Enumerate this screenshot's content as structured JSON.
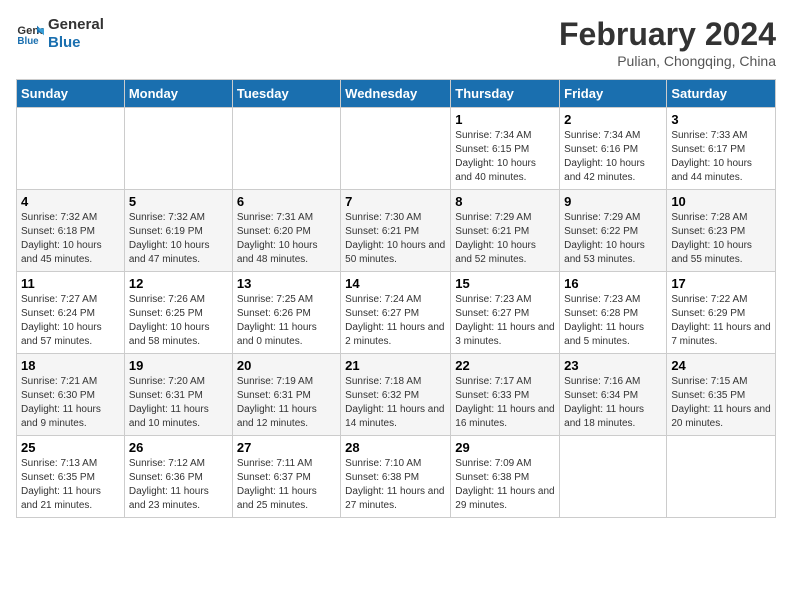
{
  "logo": {
    "line1": "General",
    "line2": "Blue"
  },
  "title": "February 2024",
  "subtitle": "Pulian, Chongqing, China",
  "days_of_week": [
    "Sunday",
    "Monday",
    "Tuesday",
    "Wednesday",
    "Thursday",
    "Friday",
    "Saturday"
  ],
  "weeks": [
    [
      {
        "num": "",
        "info": ""
      },
      {
        "num": "",
        "info": ""
      },
      {
        "num": "",
        "info": ""
      },
      {
        "num": "",
        "info": ""
      },
      {
        "num": "1",
        "info": "Sunrise: 7:34 AM\nSunset: 6:15 PM\nDaylight: 10 hours and 40 minutes."
      },
      {
        "num": "2",
        "info": "Sunrise: 7:34 AM\nSunset: 6:16 PM\nDaylight: 10 hours and 42 minutes."
      },
      {
        "num": "3",
        "info": "Sunrise: 7:33 AM\nSunset: 6:17 PM\nDaylight: 10 hours and 44 minutes."
      }
    ],
    [
      {
        "num": "4",
        "info": "Sunrise: 7:32 AM\nSunset: 6:18 PM\nDaylight: 10 hours and 45 minutes."
      },
      {
        "num": "5",
        "info": "Sunrise: 7:32 AM\nSunset: 6:19 PM\nDaylight: 10 hours and 47 minutes."
      },
      {
        "num": "6",
        "info": "Sunrise: 7:31 AM\nSunset: 6:20 PM\nDaylight: 10 hours and 48 minutes."
      },
      {
        "num": "7",
        "info": "Sunrise: 7:30 AM\nSunset: 6:21 PM\nDaylight: 10 hours and 50 minutes."
      },
      {
        "num": "8",
        "info": "Sunrise: 7:29 AM\nSunset: 6:21 PM\nDaylight: 10 hours and 52 minutes."
      },
      {
        "num": "9",
        "info": "Sunrise: 7:29 AM\nSunset: 6:22 PM\nDaylight: 10 hours and 53 minutes."
      },
      {
        "num": "10",
        "info": "Sunrise: 7:28 AM\nSunset: 6:23 PM\nDaylight: 10 hours and 55 minutes."
      }
    ],
    [
      {
        "num": "11",
        "info": "Sunrise: 7:27 AM\nSunset: 6:24 PM\nDaylight: 10 hours and 57 minutes."
      },
      {
        "num": "12",
        "info": "Sunrise: 7:26 AM\nSunset: 6:25 PM\nDaylight: 10 hours and 58 minutes."
      },
      {
        "num": "13",
        "info": "Sunrise: 7:25 AM\nSunset: 6:26 PM\nDaylight: 11 hours and 0 minutes."
      },
      {
        "num": "14",
        "info": "Sunrise: 7:24 AM\nSunset: 6:27 PM\nDaylight: 11 hours and 2 minutes."
      },
      {
        "num": "15",
        "info": "Sunrise: 7:23 AM\nSunset: 6:27 PM\nDaylight: 11 hours and 3 minutes."
      },
      {
        "num": "16",
        "info": "Sunrise: 7:23 AM\nSunset: 6:28 PM\nDaylight: 11 hours and 5 minutes."
      },
      {
        "num": "17",
        "info": "Sunrise: 7:22 AM\nSunset: 6:29 PM\nDaylight: 11 hours and 7 minutes."
      }
    ],
    [
      {
        "num": "18",
        "info": "Sunrise: 7:21 AM\nSunset: 6:30 PM\nDaylight: 11 hours and 9 minutes."
      },
      {
        "num": "19",
        "info": "Sunrise: 7:20 AM\nSunset: 6:31 PM\nDaylight: 11 hours and 10 minutes."
      },
      {
        "num": "20",
        "info": "Sunrise: 7:19 AM\nSunset: 6:31 PM\nDaylight: 11 hours and 12 minutes."
      },
      {
        "num": "21",
        "info": "Sunrise: 7:18 AM\nSunset: 6:32 PM\nDaylight: 11 hours and 14 minutes."
      },
      {
        "num": "22",
        "info": "Sunrise: 7:17 AM\nSunset: 6:33 PM\nDaylight: 11 hours and 16 minutes."
      },
      {
        "num": "23",
        "info": "Sunrise: 7:16 AM\nSunset: 6:34 PM\nDaylight: 11 hours and 18 minutes."
      },
      {
        "num": "24",
        "info": "Sunrise: 7:15 AM\nSunset: 6:35 PM\nDaylight: 11 hours and 20 minutes."
      }
    ],
    [
      {
        "num": "25",
        "info": "Sunrise: 7:13 AM\nSunset: 6:35 PM\nDaylight: 11 hours and 21 minutes."
      },
      {
        "num": "26",
        "info": "Sunrise: 7:12 AM\nSunset: 6:36 PM\nDaylight: 11 hours and 23 minutes."
      },
      {
        "num": "27",
        "info": "Sunrise: 7:11 AM\nSunset: 6:37 PM\nDaylight: 11 hours and 25 minutes."
      },
      {
        "num": "28",
        "info": "Sunrise: 7:10 AM\nSunset: 6:38 PM\nDaylight: 11 hours and 27 minutes."
      },
      {
        "num": "29",
        "info": "Sunrise: 7:09 AM\nSunset: 6:38 PM\nDaylight: 11 hours and 29 minutes."
      },
      {
        "num": "",
        "info": ""
      },
      {
        "num": "",
        "info": ""
      }
    ]
  ]
}
